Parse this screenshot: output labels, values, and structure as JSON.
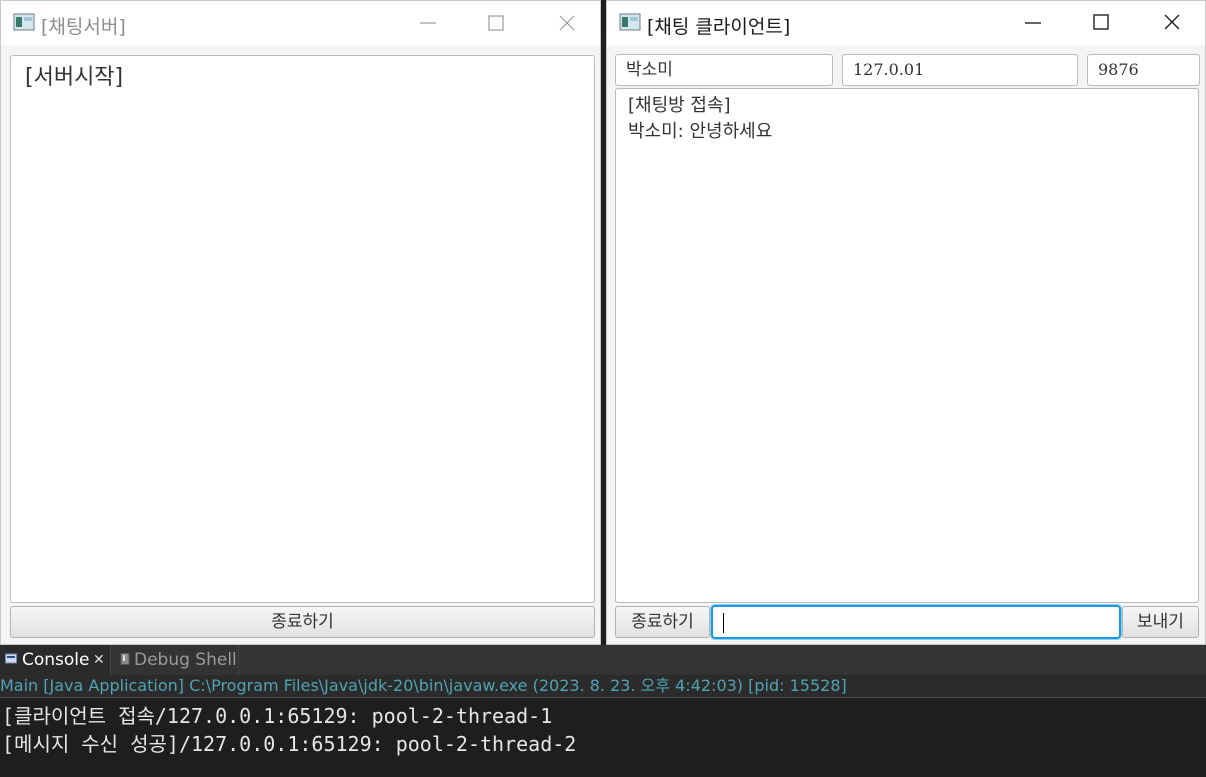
{
  "server_window": {
    "title": "[채팅서버]",
    "log_text": "[서버시작]",
    "exit_label": "종료하기"
  },
  "client_window": {
    "title": "[채팅 클라이언트]",
    "name_value": "박소미",
    "ip_value": "127.0.01",
    "port_value": "9876",
    "chat_log": "[채팅방 접속]\n박소미: 안녕하세요",
    "exit_label": "종료하기",
    "message_value": "",
    "send_label": "보내기"
  },
  "console": {
    "tabs": [
      {
        "label": "Console",
        "active": true
      },
      {
        "label": "Debug Shell",
        "active": false
      }
    ],
    "launch_line": "Main [Java Application] C:\\Program Files\\Java\\jdk-20\\bin\\javaw.exe  (2023. 8. 23. 오후 4:42:03) [pid: 15528]",
    "lines": [
      "[클라이언트 접속/127.0.0.1:65129: pool-2-thread-1",
      "[메시지 수신 성공]/127.0.0.1:65129: pool-2-thread-2"
    ]
  },
  "colors": {
    "focus_border": "#1a9be0",
    "launch_text": "#4fa3b5",
    "console_bg": "#1e1e1e"
  },
  "icons": [
    "app-icon",
    "minimize-icon",
    "maximize-icon",
    "close-icon",
    "console-icon",
    "debug-shell-icon"
  ]
}
